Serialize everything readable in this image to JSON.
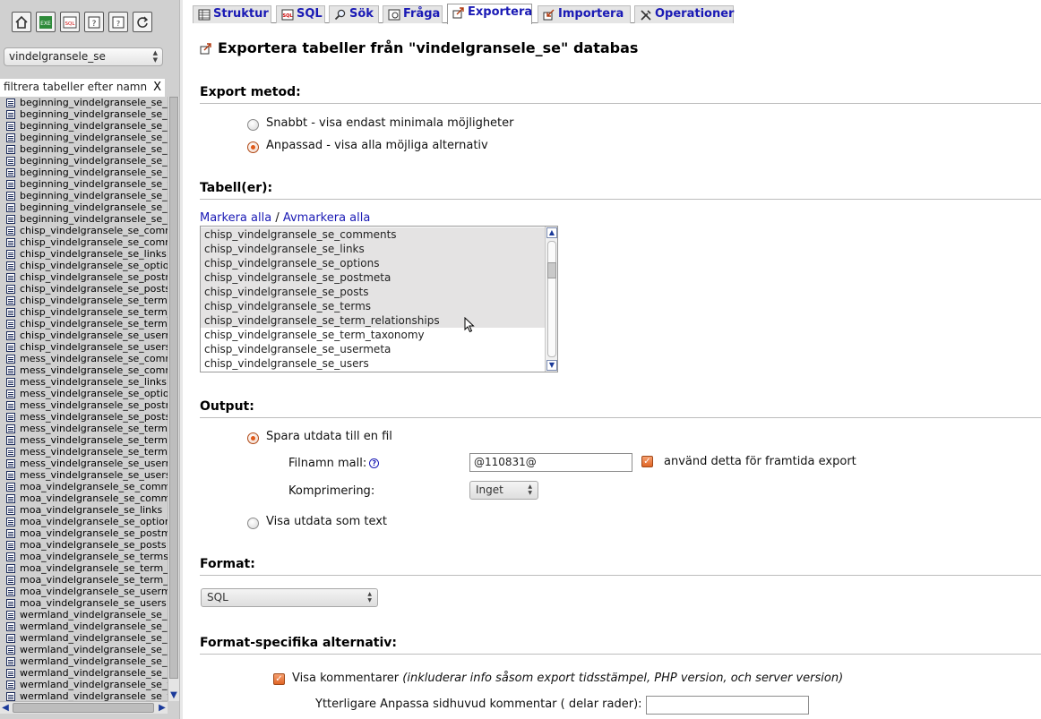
{
  "nav": {
    "icons": [
      {
        "name": "home-icon"
      },
      {
        "name": "excel-icon"
      },
      {
        "name": "sql-query-icon"
      },
      {
        "name": "docs-icon"
      },
      {
        "name": "help-icon"
      },
      {
        "name": "reload-icon"
      }
    ],
    "database": "vindelgransele_se",
    "filter_placeholder": "filtrera tabeller efter namn",
    "filter_clear": "X",
    "tables": [
      "beginning_vindelgransele_se_commentmeta",
      "beginning_vindelgransele_se_comments",
      "beginning_vindelgransele_se_links",
      "beginning_vindelgransele_se_options",
      "beginning_vindelgransele_se_postmeta",
      "beginning_vindelgransele_se_posts",
      "beginning_vindelgransele_se_terms",
      "beginning_vindelgransele_se_term_relationships",
      "beginning_vindelgransele_se_term_taxonomy",
      "beginning_vindelgransele_se_usermeta",
      "beginning_vindelgransele_se_users",
      "chisp_vindelgransele_se_commentmeta",
      "chisp_vindelgransele_se_comments",
      "chisp_vindelgransele_se_links",
      "chisp_vindelgransele_se_options",
      "chisp_vindelgransele_se_postmeta",
      "chisp_vindelgransele_se_posts",
      "chisp_vindelgransele_se_terms",
      "chisp_vindelgransele_se_term_relationships",
      "chisp_vindelgransele_se_term_taxonomy",
      "chisp_vindelgransele_se_usermeta",
      "chisp_vindelgransele_se_users",
      "mess_vindelgransele_se_commentmeta",
      "mess_vindelgransele_se_comments",
      "mess_vindelgransele_se_links",
      "mess_vindelgransele_se_options",
      "mess_vindelgransele_se_postmeta",
      "mess_vindelgransele_se_posts",
      "mess_vindelgransele_se_terms",
      "mess_vindelgransele_se_term_relationships",
      "mess_vindelgransele_se_term_taxonomy",
      "mess_vindelgransele_se_usermeta",
      "mess_vindelgransele_se_users",
      "moa_vindelgransele_se_commentmeta",
      "moa_vindelgransele_se_comments",
      "moa_vindelgransele_se_links",
      "moa_vindelgransele_se_options",
      "moa_vindelgransele_se_postmeta",
      "moa_vindelgransele_se_posts",
      "moa_vindelgransele_se_terms",
      "moa_vindelgransele_se_term_relationships",
      "moa_vindelgransele_se_term_taxonomy",
      "moa_vindelgransele_se_usermeta",
      "moa_vindelgransele_se_users",
      "wermland_vindelgransele_se_commentmeta",
      "wermland_vindelgransele_se_comments",
      "wermland_vindelgransele_se_links",
      "wermland_vindelgransele_se_options",
      "wermland_vindelgransele_se_postmeta",
      "wermland_vindelgransele_se_posts",
      "wermland_vindelgransele_se_terms",
      "wermland_vindelgransele_se_term_relationships"
    ]
  },
  "tabs": [
    {
      "label": "Struktur",
      "icon": "structure-icon",
      "active": false
    },
    {
      "label": "SQL",
      "icon": "sql-icon",
      "active": false
    },
    {
      "label": "Sök",
      "icon": "search-icon",
      "active": false
    },
    {
      "label": "Fråga",
      "icon": "query-icon",
      "active": false
    },
    {
      "label": "Exportera",
      "icon": "export-icon",
      "active": true
    },
    {
      "label": "Importera",
      "icon": "import-icon",
      "active": false
    },
    {
      "label": "Operationer",
      "icon": "operations-icon",
      "active": false
    }
  ],
  "page": {
    "title": "Exportera tabeller från \"vindelgransele_se\" databas",
    "title_icon": "export-icon"
  },
  "export_method": {
    "heading": "Export metod:",
    "quick_label": "Snabbt - visa endast minimala möjligheter",
    "custom_label": "Anpassad - visa alla möjliga alternativ",
    "selected": "custom"
  },
  "tables_section": {
    "heading": "Tabell(er):",
    "select_all": "Markera alla",
    "separator": " / ",
    "deselect_all": "Avmarkera alla",
    "options": [
      {
        "name": "chisp_vindelgransele_se_comments",
        "selected": true
      },
      {
        "name": "chisp_vindelgransele_se_links",
        "selected": true
      },
      {
        "name": "chisp_vindelgransele_se_options",
        "selected": true
      },
      {
        "name": "chisp_vindelgransele_se_postmeta",
        "selected": true
      },
      {
        "name": "chisp_vindelgransele_se_posts",
        "selected": true
      },
      {
        "name": "chisp_vindelgransele_se_terms",
        "selected": true
      },
      {
        "name": "chisp_vindelgransele_se_term_relationships",
        "selected": true
      },
      {
        "name": "chisp_vindelgransele_se_term_taxonomy",
        "selected": false
      },
      {
        "name": "chisp_vindelgransele_se_usermeta",
        "selected": false
      },
      {
        "name": "chisp_vindelgransele_se_users",
        "selected": false
      }
    ]
  },
  "output": {
    "heading": "Output:",
    "save_to_file_label": "Spara utdata till en fil",
    "filename_label": "Filnamn mall:",
    "filename_value": "@110831@",
    "remember_label": "använd detta för framtida export",
    "remember_checked": true,
    "compression_label": "Komprimering:",
    "compression_value": "Inget",
    "as_text_label": "Visa utdata som text",
    "selected": "file"
  },
  "format": {
    "heading": "Format:",
    "value": "SQL"
  },
  "format_options": {
    "heading": "Format-specifika alternativ:",
    "comments_label": "Visa kommentarer",
    "comments_note": "(inkluderar info såsom export tidsstämpel, PHP version, och server version)",
    "comments_checked": true,
    "header_comment_label": "Ytterligare Anpassa sidhuvud kommentar ( delar rader):",
    "header_comment_value": ""
  },
  "colors": {
    "accent": "#e06525",
    "link": "#1a1ab5",
    "nav_bg": "#d0d0d0"
  }
}
